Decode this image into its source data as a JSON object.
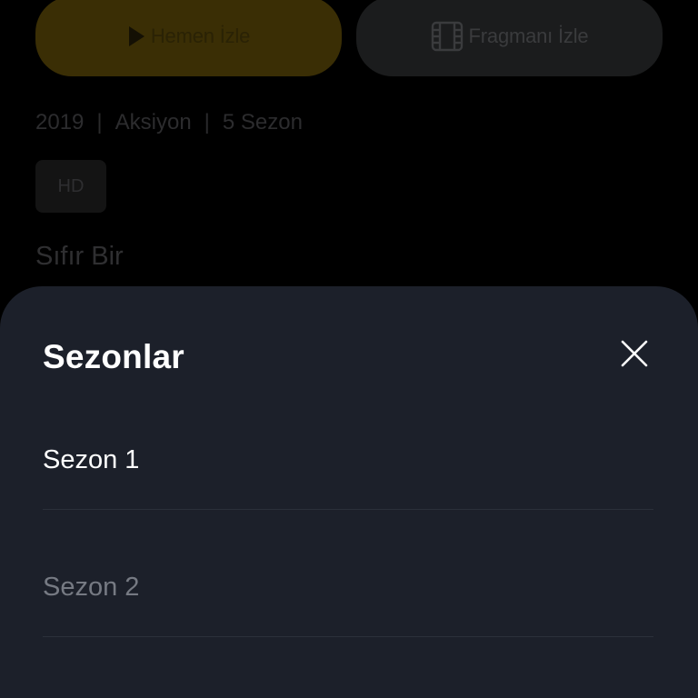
{
  "actions": {
    "watch_label": "Hemen İzle",
    "trailer_label": "Fragmanı İzle"
  },
  "meta": {
    "year": "2019",
    "genre": "Aksiyon",
    "seasons_count": "5 Sezon",
    "separator": "|"
  },
  "badge": {
    "quality": "HD"
  },
  "show": {
    "title": "Sıfır Bir"
  },
  "sheet": {
    "title": "Sezonlar",
    "seasons": [
      {
        "label": "Sezon 1",
        "selected": true
      },
      {
        "label": "Sezon 2",
        "selected": false
      }
    ]
  },
  "colors": {
    "sheet_bg": "#1c202a",
    "watch_button_dim": "#3a2e05",
    "text_active": "#ffffff",
    "text_inactive": "#767a83"
  },
  "icons": {
    "watch": "play-icon",
    "trailer": "film-icon",
    "close": "close-icon"
  }
}
